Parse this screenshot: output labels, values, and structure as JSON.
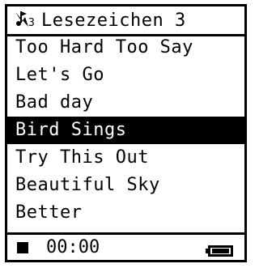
{
  "header": {
    "icon": "bookmark-music-note-icon",
    "icon_number": "3",
    "title": "Lesezeichen 3"
  },
  "list": {
    "items": [
      {
        "label": "Too Hard Too Say"
      },
      {
        "label": "Let's Go"
      },
      {
        "label": "Bad day"
      },
      {
        "label": "Bird Sings",
        "selected": true
      },
      {
        "label": "Try This Out"
      },
      {
        "label": "Beautiful Sky"
      },
      {
        "label": "Better"
      }
    ]
  },
  "footer": {
    "status_icon": "stop-icon",
    "time": "00:00",
    "battery_icon": "battery-full-icon"
  }
}
